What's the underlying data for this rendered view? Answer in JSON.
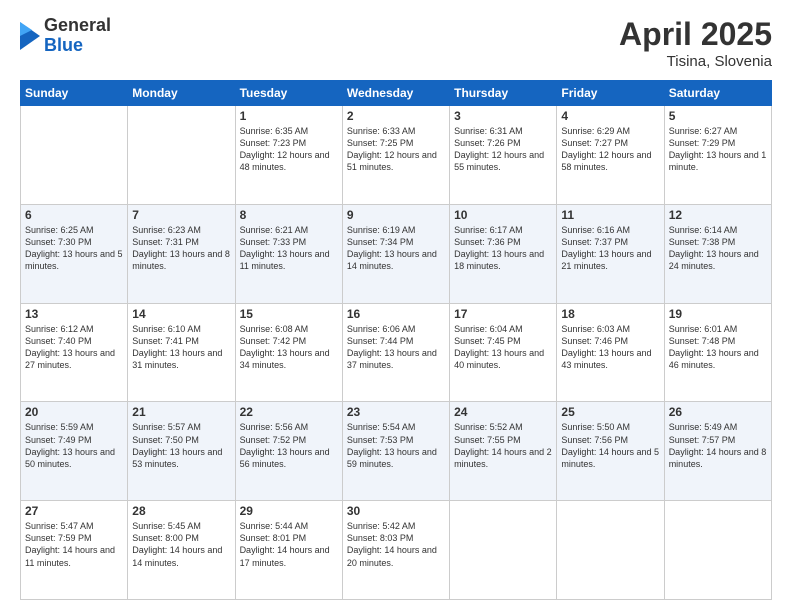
{
  "logo": {
    "general": "General",
    "blue": "Blue"
  },
  "title": "April 2025",
  "location": "Tisina, Slovenia",
  "days_of_week": [
    "Sunday",
    "Monday",
    "Tuesday",
    "Wednesday",
    "Thursday",
    "Friday",
    "Saturday"
  ],
  "weeks": [
    [
      {
        "day": "",
        "info": ""
      },
      {
        "day": "",
        "info": ""
      },
      {
        "day": "1",
        "info": "Sunrise: 6:35 AM\nSunset: 7:23 PM\nDaylight: 12 hours and 48 minutes."
      },
      {
        "day": "2",
        "info": "Sunrise: 6:33 AM\nSunset: 7:25 PM\nDaylight: 12 hours and 51 minutes."
      },
      {
        "day": "3",
        "info": "Sunrise: 6:31 AM\nSunset: 7:26 PM\nDaylight: 12 hours and 55 minutes."
      },
      {
        "day": "4",
        "info": "Sunrise: 6:29 AM\nSunset: 7:27 PM\nDaylight: 12 hours and 58 minutes."
      },
      {
        "day": "5",
        "info": "Sunrise: 6:27 AM\nSunset: 7:29 PM\nDaylight: 13 hours and 1 minute."
      }
    ],
    [
      {
        "day": "6",
        "info": "Sunrise: 6:25 AM\nSunset: 7:30 PM\nDaylight: 13 hours and 5 minutes."
      },
      {
        "day": "7",
        "info": "Sunrise: 6:23 AM\nSunset: 7:31 PM\nDaylight: 13 hours and 8 minutes."
      },
      {
        "day": "8",
        "info": "Sunrise: 6:21 AM\nSunset: 7:33 PM\nDaylight: 13 hours and 11 minutes."
      },
      {
        "day": "9",
        "info": "Sunrise: 6:19 AM\nSunset: 7:34 PM\nDaylight: 13 hours and 14 minutes."
      },
      {
        "day": "10",
        "info": "Sunrise: 6:17 AM\nSunset: 7:36 PM\nDaylight: 13 hours and 18 minutes."
      },
      {
        "day": "11",
        "info": "Sunrise: 6:16 AM\nSunset: 7:37 PM\nDaylight: 13 hours and 21 minutes."
      },
      {
        "day": "12",
        "info": "Sunrise: 6:14 AM\nSunset: 7:38 PM\nDaylight: 13 hours and 24 minutes."
      }
    ],
    [
      {
        "day": "13",
        "info": "Sunrise: 6:12 AM\nSunset: 7:40 PM\nDaylight: 13 hours and 27 minutes."
      },
      {
        "day": "14",
        "info": "Sunrise: 6:10 AM\nSunset: 7:41 PM\nDaylight: 13 hours and 31 minutes."
      },
      {
        "day": "15",
        "info": "Sunrise: 6:08 AM\nSunset: 7:42 PM\nDaylight: 13 hours and 34 minutes."
      },
      {
        "day": "16",
        "info": "Sunrise: 6:06 AM\nSunset: 7:44 PM\nDaylight: 13 hours and 37 minutes."
      },
      {
        "day": "17",
        "info": "Sunrise: 6:04 AM\nSunset: 7:45 PM\nDaylight: 13 hours and 40 minutes."
      },
      {
        "day": "18",
        "info": "Sunrise: 6:03 AM\nSunset: 7:46 PM\nDaylight: 13 hours and 43 minutes."
      },
      {
        "day": "19",
        "info": "Sunrise: 6:01 AM\nSunset: 7:48 PM\nDaylight: 13 hours and 46 minutes."
      }
    ],
    [
      {
        "day": "20",
        "info": "Sunrise: 5:59 AM\nSunset: 7:49 PM\nDaylight: 13 hours and 50 minutes."
      },
      {
        "day": "21",
        "info": "Sunrise: 5:57 AM\nSunset: 7:50 PM\nDaylight: 13 hours and 53 minutes."
      },
      {
        "day": "22",
        "info": "Sunrise: 5:56 AM\nSunset: 7:52 PM\nDaylight: 13 hours and 56 minutes."
      },
      {
        "day": "23",
        "info": "Sunrise: 5:54 AM\nSunset: 7:53 PM\nDaylight: 13 hours and 59 minutes."
      },
      {
        "day": "24",
        "info": "Sunrise: 5:52 AM\nSunset: 7:55 PM\nDaylight: 14 hours and 2 minutes."
      },
      {
        "day": "25",
        "info": "Sunrise: 5:50 AM\nSunset: 7:56 PM\nDaylight: 14 hours and 5 minutes."
      },
      {
        "day": "26",
        "info": "Sunrise: 5:49 AM\nSunset: 7:57 PM\nDaylight: 14 hours and 8 minutes."
      }
    ],
    [
      {
        "day": "27",
        "info": "Sunrise: 5:47 AM\nSunset: 7:59 PM\nDaylight: 14 hours and 11 minutes."
      },
      {
        "day": "28",
        "info": "Sunrise: 5:45 AM\nSunset: 8:00 PM\nDaylight: 14 hours and 14 minutes."
      },
      {
        "day": "29",
        "info": "Sunrise: 5:44 AM\nSunset: 8:01 PM\nDaylight: 14 hours and 17 minutes."
      },
      {
        "day": "30",
        "info": "Sunrise: 5:42 AM\nSunset: 8:03 PM\nDaylight: 14 hours and 20 minutes."
      },
      {
        "day": "",
        "info": ""
      },
      {
        "day": "",
        "info": ""
      },
      {
        "day": "",
        "info": ""
      }
    ]
  ]
}
